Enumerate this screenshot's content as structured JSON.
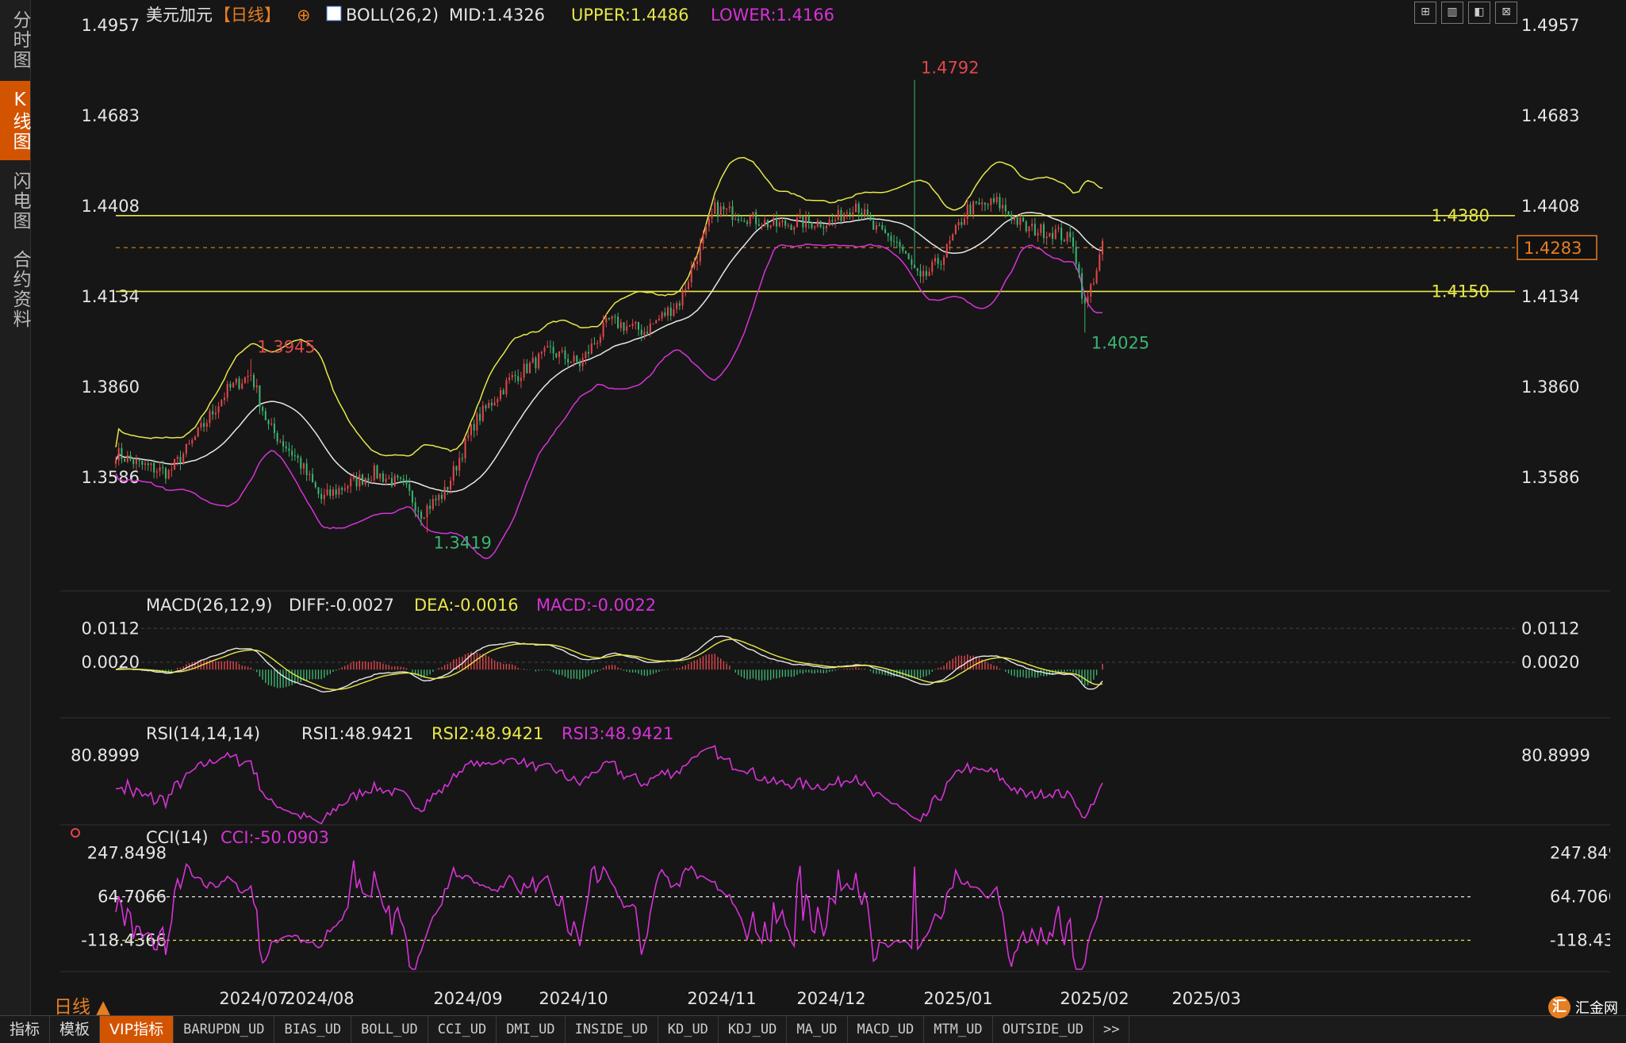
{
  "left_tabs": [
    {
      "label": "分时图",
      "active": false
    },
    {
      "label": "K线图",
      "active": true
    },
    {
      "label": "闪电图",
      "active": false
    },
    {
      "label": "合约资料",
      "active": false
    }
  ],
  "main": {
    "symbol": "美元加元",
    "period_bracket": "【日线】",
    "boll_label": "BOLL(26,2)",
    "mid_label": "MID:1.4326",
    "upper_label": "UPPER:1.4486",
    "lower_label": "LOWER:1.4166",
    "y_ticks": [
      "1.4957",
      "1.4683",
      "1.4408",
      "1.4134",
      "1.3860",
      "1.3586"
    ],
    "current_price": "1.4283",
    "high_label": "1.4792",
    "low_label": "1.3419",
    "peak_label": "1.3945",
    "dip_label": "1.4025",
    "hline_upper": "1.4380",
    "hline_lower": "1.4150"
  },
  "macd": {
    "title": "MACD(26,12,9)",
    "diff": "DIFF:-0.0027",
    "dea": "DEA:-0.0016",
    "macd": "MACD:-0.0022",
    "y_ticks": [
      "0.0112",
      "0.0020"
    ]
  },
  "rsi": {
    "title": "RSI(14,14,14)",
    "rsi1": "RSI1:48.9421",
    "rsi2": "RSI2:48.9421",
    "rsi3": "RSI3:48.9421",
    "y_ticks": [
      "80.8999"
    ]
  },
  "cci": {
    "title": "CCI(14)",
    "cci": "CCI:-50.0903",
    "y_ticks": [
      "247.8498",
      "64.7066",
      "-118.4366"
    ]
  },
  "x_axis": {
    "labels": [
      "2024/07",
      "2024/08",
      "2024/09",
      "2024/10",
      "2024/11",
      "2024/12",
      "2025/01",
      "2025/02",
      "2025/03"
    ]
  },
  "period_label": "日线 ▲",
  "bottom_tabs": [
    {
      "label": "指标",
      "active": false,
      "small": false
    },
    {
      "label": "模板",
      "active": false,
      "small": false
    },
    {
      "label": "VIP指标",
      "active": true,
      "small": false
    },
    {
      "label": "BARUPDN_UD",
      "active": false,
      "small": true
    },
    {
      "label": "BIAS_UD",
      "active": false,
      "small": true
    },
    {
      "label": "BOLL_UD",
      "active": false,
      "small": true
    },
    {
      "label": "CCI_UD",
      "active": false,
      "small": true
    },
    {
      "label": "DMI_UD",
      "active": false,
      "small": true
    },
    {
      "label": "INSIDE_UD",
      "active": false,
      "small": true
    },
    {
      "label": "KD_UD",
      "active": false,
      "small": true
    },
    {
      "label": "KDJ_UD",
      "active": false,
      "small": true
    },
    {
      "label": "MA_UD",
      "active": false,
      "small": true
    },
    {
      "label": "MACD_UD",
      "active": false,
      "small": true
    },
    {
      "label": "MTM_UD",
      "active": false,
      "small": true
    },
    {
      "label": "OUTSIDE_UD",
      "active": false,
      "small": true
    },
    {
      "label": ">>",
      "active": false,
      "small": true
    }
  ],
  "brand": {
    "name": "汇金网",
    "logo_char": "汇"
  },
  "colors": {
    "up": "#e0474c",
    "down": "#3cb371",
    "upper": "#e8e84a",
    "mid": "#e8e8e8",
    "lower": "#d633d6",
    "accent": "#e67e22",
    "hline": "#e8e84a"
  },
  "toolbar_icons": [
    "grid-icon",
    "chart-icon",
    "indicator-icon",
    "close-icon"
  ],
  "chart_data": {
    "type": "candlestick",
    "title": "",
    "x": [
      "2024/07",
      "2024/08",
      "2024/09",
      "2024/10",
      "2024/11",
      "2024/12",
      "2025/01",
      "2025/02",
      "2025/03"
    ],
    "ylim": [
      1.335,
      1.4957
    ],
    "waypoints": [
      [
        0,
        1.366
      ],
      [
        8,
        1.3625
      ],
      [
        18,
        1.36
      ],
      [
        25,
        1.368
      ],
      [
        38,
        1.385
      ],
      [
        46,
        1.39
      ],
      [
        52,
        1.374
      ],
      [
        62,
        1.364
      ],
      [
        70,
        1.352
      ],
      [
        78,
        1.356
      ],
      [
        88,
        1.36
      ],
      [
        98,
        1.356
      ],
      [
        104,
        1.348
      ],
      [
        112,
        1.354
      ],
      [
        122,
        1.375
      ],
      [
        134,
        1.388
      ],
      [
        148,
        1.397
      ],
      [
        158,
        1.393
      ],
      [
        168,
        1.406
      ],
      [
        180,
        1.403
      ],
      [
        192,
        1.412
      ],
      [
        204,
        1.44
      ],
      [
        214,
        1.438
      ],
      [
        224,
        1.435
      ],
      [
        234,
        1.436
      ],
      [
        244,
        1.436
      ],
      [
        252,
        1.442
      ],
      [
        258,
        1.434
      ],
      [
        266,
        1.43
      ],
      [
        274,
        1.418
      ],
      [
        282,
        1.426
      ],
      [
        290,
        1.44
      ],
      [
        300,
        1.442
      ],
      [
        310,
        1.434
      ],
      [
        320,
        1.433
      ],
      [
        326,
        1.43
      ],
      [
        330,
        1.41
      ],
      [
        336,
        1.4283
      ]
    ],
    "highs_lows": {
      "high": {
        "index": 272,
        "value": 1.4792
      },
      "low": {
        "index": 106,
        "value": 1.3419
      }
    }
  }
}
